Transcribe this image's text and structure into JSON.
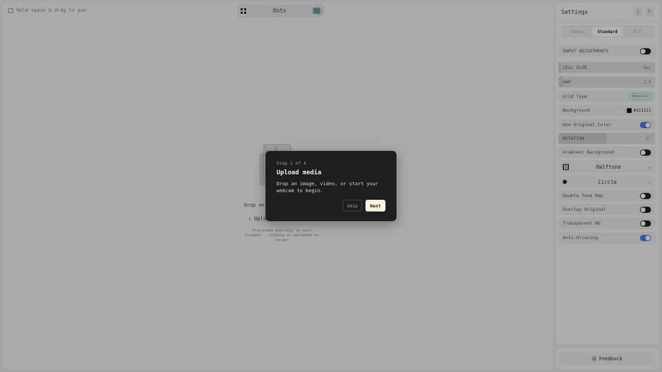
{
  "canvas": {
    "hint": "Hold space & drag to pan",
    "mode_label": "Dots",
    "drop_text": "Drop an image",
    "upload_label": "Upload",
    "footnote": "Processed entirely in your browser · nothing is uploaded to server"
  },
  "tour": {
    "step": "Step 1 of 4",
    "title": "Upload media",
    "body": "Drop an image, video, or start your webcam to begin.",
    "skip_label": "Skip",
    "next_label": "Next"
  },
  "settings": {
    "title": "Settings",
    "tabs": [
      "Simple",
      "Standard",
      "Pro"
    ],
    "active_tab": "Standard",
    "input_adjustments": {
      "label": "INPUT ADJUSTMENTS",
      "on": false
    },
    "cell_size": {
      "label": "CELL SIZE",
      "value": "8px",
      "level": 0.02
    },
    "gap": {
      "label": "GAP",
      "value": "1.0",
      "level": 0.04
    },
    "grid_type": {
      "label": "Grid Type",
      "value": "Regular"
    },
    "background": {
      "label": "Background",
      "value": "#111111",
      "color": "#111111"
    },
    "use_original_color": {
      "label": "Use Original Color",
      "on": true
    },
    "rotation": {
      "label": "ROTATION",
      "value": "0°",
      "level": 0.5
    },
    "gradient_background": {
      "label": "Gradient Background",
      "on": false
    },
    "pattern_select": {
      "label": "Halftone",
      "icon": "grid-icon"
    },
    "shape_select": {
      "label": "Circle",
      "icon": "circle-icon"
    },
    "double_tone_map": {
      "label": "Double Tone Map",
      "on": false
    },
    "overlay_original": {
      "label": "Overlay Original",
      "on": false
    },
    "transparent_bg": {
      "label": "Transparent BG",
      "on": false
    },
    "anti_aliasing": {
      "label": "Anti-Aliasing",
      "on": true
    }
  },
  "feedback": {
    "label": "Feedback"
  },
  "colors": {
    "accent_toggle": "#4c7bd9",
    "teal": "#5ba7a1",
    "modal_bg": "#1e1e1e"
  }
}
